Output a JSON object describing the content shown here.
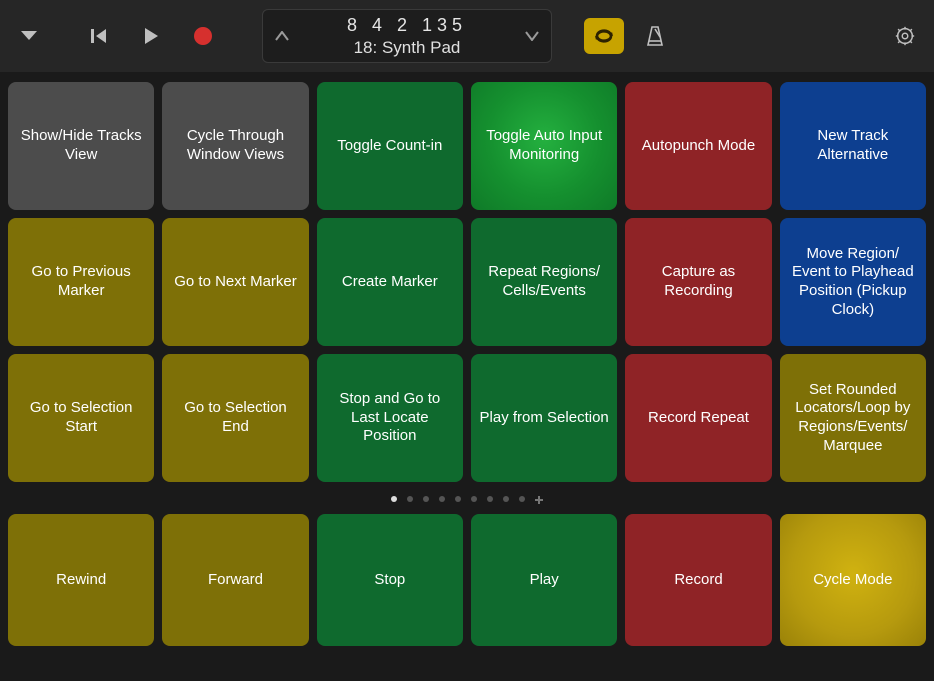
{
  "lcd": {
    "position": "8  4  2  135",
    "track": "18: Synth Pad"
  },
  "page_dots": {
    "count": 9,
    "active_index": 0,
    "show_plus": true
  },
  "pads": [
    [
      {
        "label": "Show/Hide Tracks View",
        "name": "show-hide-tracks-view",
        "color": "gray"
      },
      {
        "label": "Cycle Through Window Views",
        "name": "cycle-through-window-views",
        "color": "gray"
      },
      {
        "label": "Toggle Count-in",
        "name": "toggle-count-in",
        "color": "green"
      },
      {
        "label": "Toggle Auto Input Monitoring",
        "name": "toggle-auto-input-monitoring",
        "color": "green-lit"
      },
      {
        "label": "Autopunch Mode",
        "name": "autopunch-mode",
        "color": "red"
      },
      {
        "label": "New Track Alternative",
        "name": "new-track-alternative",
        "color": "blue"
      }
    ],
    [
      {
        "label": "Go to Previous Marker",
        "name": "go-to-previous-marker",
        "color": "olive"
      },
      {
        "label": "Go to Next Marker",
        "name": "go-to-next-marker",
        "color": "olive"
      },
      {
        "label": "Create Marker",
        "name": "create-marker",
        "color": "green"
      },
      {
        "label": "Repeat Regions/\nCells/Events",
        "name": "repeat-regions-cells-events",
        "color": "green"
      },
      {
        "label": "Capture as Recording",
        "name": "capture-as-recording",
        "color": "red"
      },
      {
        "label": "Move Region/\nEvent to Playhead Position (Pickup Clock)",
        "name": "move-region-to-playhead",
        "color": "blue"
      }
    ],
    [
      {
        "label": "Go to Selection Start",
        "name": "go-to-selection-start",
        "color": "olive"
      },
      {
        "label": "Go to Selection End",
        "name": "go-to-selection-end",
        "color": "olive"
      },
      {
        "label": "Stop and Go to Last Locate Position",
        "name": "stop-go-to-last-locate",
        "color": "green"
      },
      {
        "label": "Play from Selection",
        "name": "play-from-selection",
        "color": "green"
      },
      {
        "label": "Record Repeat",
        "name": "record-repeat",
        "color": "red"
      },
      {
        "label": "Set Rounded Locators/Loop by Regions/Events/\nMarquee",
        "name": "set-rounded-locators",
        "color": "olive"
      }
    ]
  ],
  "transport": [
    {
      "label": "Rewind",
      "name": "rewind-button",
      "color": "olive"
    },
    {
      "label": "Forward",
      "name": "forward-button",
      "color": "olive"
    },
    {
      "label": "Stop",
      "name": "stop-button",
      "color": "green"
    },
    {
      "label": "Play",
      "name": "play-button",
      "color": "green"
    },
    {
      "label": "Record",
      "name": "record-button",
      "color": "red"
    },
    {
      "label": "Cycle Mode",
      "name": "cycle-mode-button",
      "color": "olive-lit"
    }
  ]
}
